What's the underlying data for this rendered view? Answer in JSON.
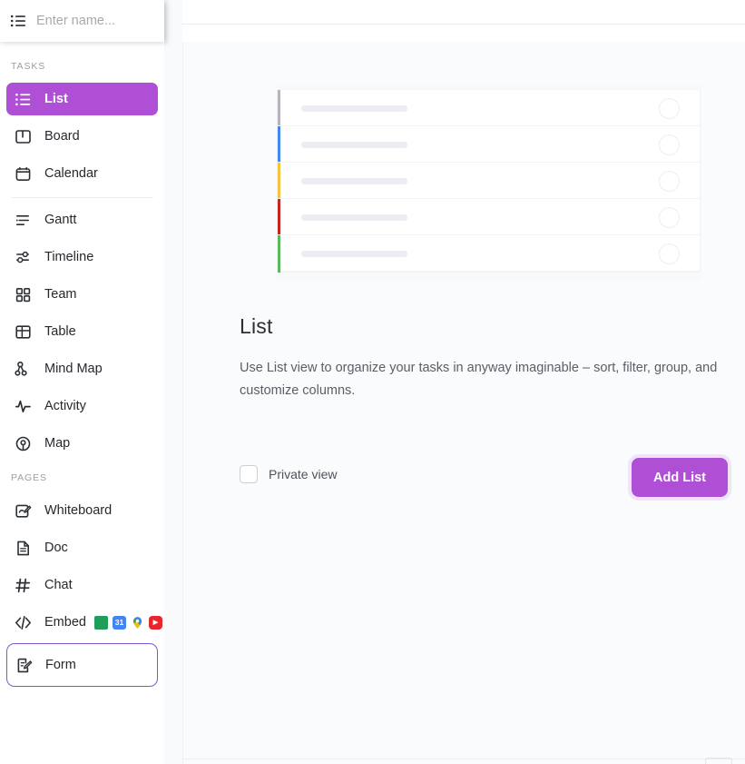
{
  "app": {
    "accent_purple": "#ae4fd6",
    "focus_purple": "#7e57d1",
    "sidebar_bg": "#ffffff",
    "main_bg": "#f9fbfd"
  },
  "sidebar": {
    "name_field": {
      "value": "",
      "placeholder": "Enter name..."
    },
    "sections": [
      {
        "label": "TASKS",
        "items": [
          {
            "label": "List",
            "icon": "list-icon",
            "state": "active"
          },
          {
            "label": "Board",
            "icon": "board-icon",
            "state": "normal"
          },
          {
            "label": "Calendar",
            "icon": "calendar-icon",
            "state": "normal"
          },
          {
            "label": "Gantt",
            "icon": "gantt-icon",
            "state": "normal",
            "divider_before": true
          },
          {
            "label": "Timeline",
            "icon": "timeline-icon",
            "state": "normal"
          },
          {
            "label": "Team",
            "icon": "team-icon",
            "state": "normal"
          },
          {
            "label": "Table",
            "icon": "table-icon",
            "state": "normal"
          },
          {
            "label": "Mind Map",
            "icon": "mind-map-icon",
            "state": "normal"
          },
          {
            "label": "Activity",
            "icon": "activity-icon",
            "state": "normal"
          },
          {
            "label": "Map",
            "icon": "map-pin-icon",
            "state": "normal"
          }
        ]
      },
      {
        "label": "PAGES",
        "items": [
          {
            "label": "Whiteboard",
            "icon": "whiteboard-icon",
            "state": "normal"
          },
          {
            "label": "Doc",
            "icon": "doc-icon",
            "state": "normal"
          },
          {
            "label": "Chat",
            "icon": "chat-hash-icon",
            "state": "normal"
          },
          {
            "label": "Embed",
            "icon": "embed-code-icon",
            "state": "normal",
            "apps": [
              "google-sheets-icon",
              "google-calendar-icon",
              "google-maps-icon",
              "youtube-icon"
            ],
            "app_badge_text": "31"
          },
          {
            "label": "Form",
            "icon": "form-icon",
            "state": "focused"
          }
        ]
      }
    ]
  },
  "main": {
    "title": "List",
    "description": "Use List view to organize your tasks in anyway imaginable – sort, filter, group, and customize columns.",
    "private_view": {
      "label": "Private view",
      "checked": false
    },
    "add_button": "Add List",
    "preview": {
      "rows": [
        {
          "color": "#b3b5b8"
        },
        {
          "color": "#4286f5"
        },
        {
          "color": "#f5c344"
        },
        {
          "color": "#c3281f"
        },
        {
          "color": "#5cb85c"
        }
      ]
    }
  }
}
